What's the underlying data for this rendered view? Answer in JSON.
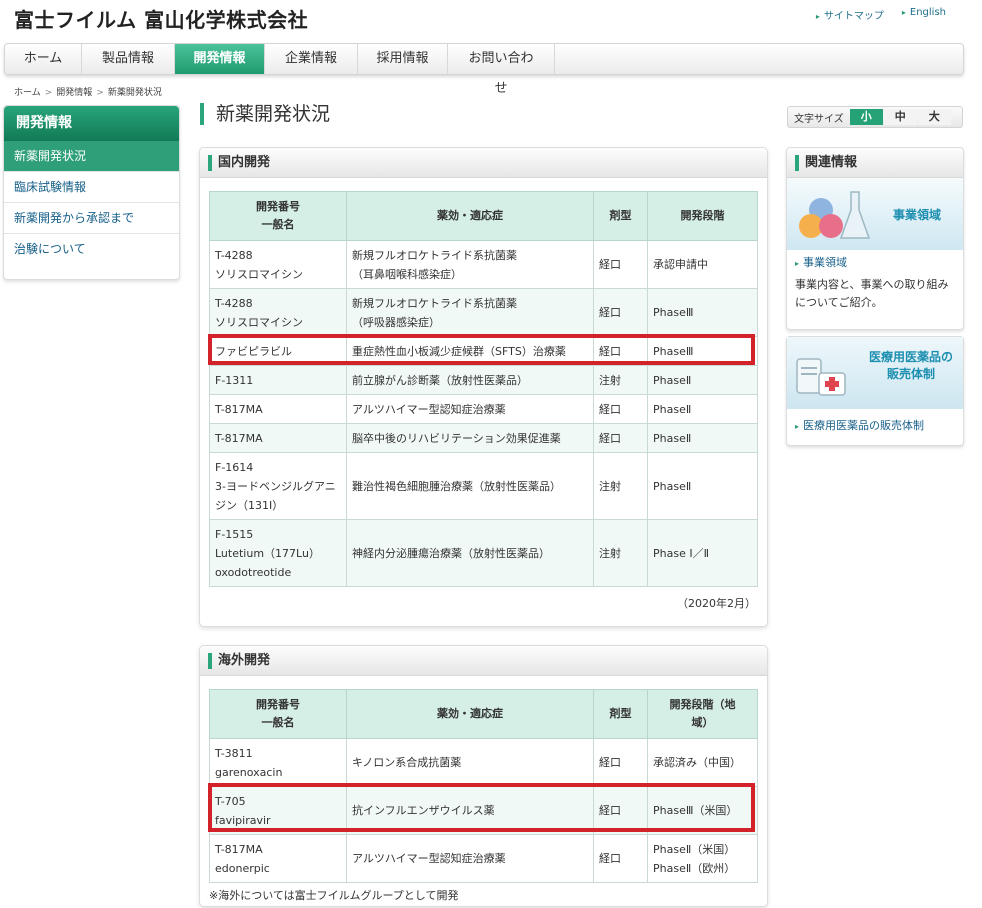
{
  "site": {
    "title": "富士フイルム 富山化学株式会社"
  },
  "top_links": [
    {
      "label": "サイトマップ"
    },
    {
      "label": "English"
    }
  ],
  "nav": [
    {
      "label": "ホーム"
    },
    {
      "label": "製品情報"
    },
    {
      "label": "開発情報"
    },
    {
      "label": "企業情報"
    },
    {
      "label": "採用情報"
    },
    {
      "label": "お問い合わせ"
    }
  ],
  "breadcrumb": [
    "ホーム",
    "開発情報",
    "新薬開発状況"
  ],
  "sidebar": {
    "title": "開発情報",
    "items": [
      {
        "label": "新薬開発状況"
      },
      {
        "label": "臨床試験情報"
      },
      {
        "label": "新薬開発から承認まで"
      },
      {
        "label": "治験について"
      }
    ]
  },
  "page_title": "新薬開発状況",
  "font_size": {
    "label": "文字サイズ",
    "options": [
      "小",
      "中",
      "大"
    ]
  },
  "domestic": {
    "title": "国内開発",
    "headers": {
      "code_1": "開発番号",
      "code_2": "一般名",
      "efficacy": "薬効・適応症",
      "form": "剤型",
      "stage": "開発段階"
    },
    "rows": [
      {
        "code": "T-4288",
        "name": "ソリスロマイシン",
        "efficacy_1": "新規フルオロケトライド系抗菌薬",
        "efficacy_2": "（耳鼻咽喉科感染症）",
        "form": "経口",
        "stage": "承認申請中"
      },
      {
        "code": "T-4288",
        "name": "ソリスロマイシン",
        "efficacy_1": "新規フルオロケトライド系抗菌薬",
        "efficacy_2": "（呼吸器感染症）",
        "form": "経口",
        "stage": "PhaseⅢ"
      },
      {
        "code": "ファビピラビル",
        "name": "",
        "efficacy_1": "重症熱性血小板減少症候群（SFTS）治療薬",
        "efficacy_2": "",
        "form": "経口",
        "stage": "PhaseⅢ"
      },
      {
        "code": "F-1311",
        "name": "",
        "efficacy_1": "前立腺がん診断薬（放射性医薬品）",
        "efficacy_2": "",
        "form": "注射",
        "stage": "PhaseⅡ"
      },
      {
        "code": "T-817MA",
        "name": "",
        "efficacy_1": "アルツハイマー型認知症治療薬",
        "efficacy_2": "",
        "form": "経口",
        "stage": "PhaseⅡ"
      },
      {
        "code": "T-817MA",
        "name": "",
        "efficacy_1": "脳卒中後のリハビリテーション効果促進薬",
        "efficacy_2": "",
        "form": "経口",
        "stage": "PhaseⅡ"
      },
      {
        "code": "F-1614",
        "name": "3-ヨードベンジルグアニジン（131I）",
        "efficacy_1": "難治性褐色細胞腫治療薬（放射性医薬品）",
        "efficacy_2": "",
        "form": "注射",
        "stage": "PhaseⅡ"
      },
      {
        "code": "F-1515",
        "name": "Lutetium（177Lu） oxodotreotide",
        "efficacy_1": "神経内分泌腫瘍治療薬（放射性医薬品）",
        "efficacy_2": "",
        "form": "注射",
        "stage": "Phase Ⅰ／Ⅱ"
      }
    ],
    "date_note": "（2020年2月）"
  },
  "overseas": {
    "title": "海外開発",
    "headers": {
      "code_1": "開発番号",
      "code_2": "一般名",
      "efficacy": "薬効・適応症",
      "form": "剤型",
      "stage_1": "開発段階（地",
      "stage_2": "域）"
    },
    "rows": [
      {
        "code": "T-3811",
        "name": "garenoxacin",
        "efficacy": "キノロン系合成抗菌薬",
        "form": "経口",
        "stage_1": "承認済み（中国）",
        "stage_2": ""
      },
      {
        "code": "T-705",
        "name": "favipiravir",
        "efficacy": "抗インフルエンザウイルス薬",
        "form": "経口",
        "stage_1": "PhaseⅢ（米国）",
        "stage_2": ""
      },
      {
        "code": "T-817MA",
        "name": "edonerpic",
        "efficacy": "アルツハイマー型認知症治療薬",
        "form": "経口",
        "stage_1": "PhaseⅡ（米国）",
        "stage_2": "PhaseⅡ（欧州）"
      }
    ],
    "foot_note": "※海外については富士フイルムグループとして開発"
  },
  "related": {
    "title": "関連情報",
    "banner1": "事業領域",
    "link1": "事業領域",
    "desc1": "事業内容と、事業への取り組みについてご紹介。",
    "banner2_1": "医療用医薬品の",
    "banner2_2": "販売体制",
    "link2": "医療用医薬品の販売体制"
  },
  "colors": {
    "accent": "#2aa57c",
    "highlight": "#d3222a",
    "link": "#17608a"
  }
}
